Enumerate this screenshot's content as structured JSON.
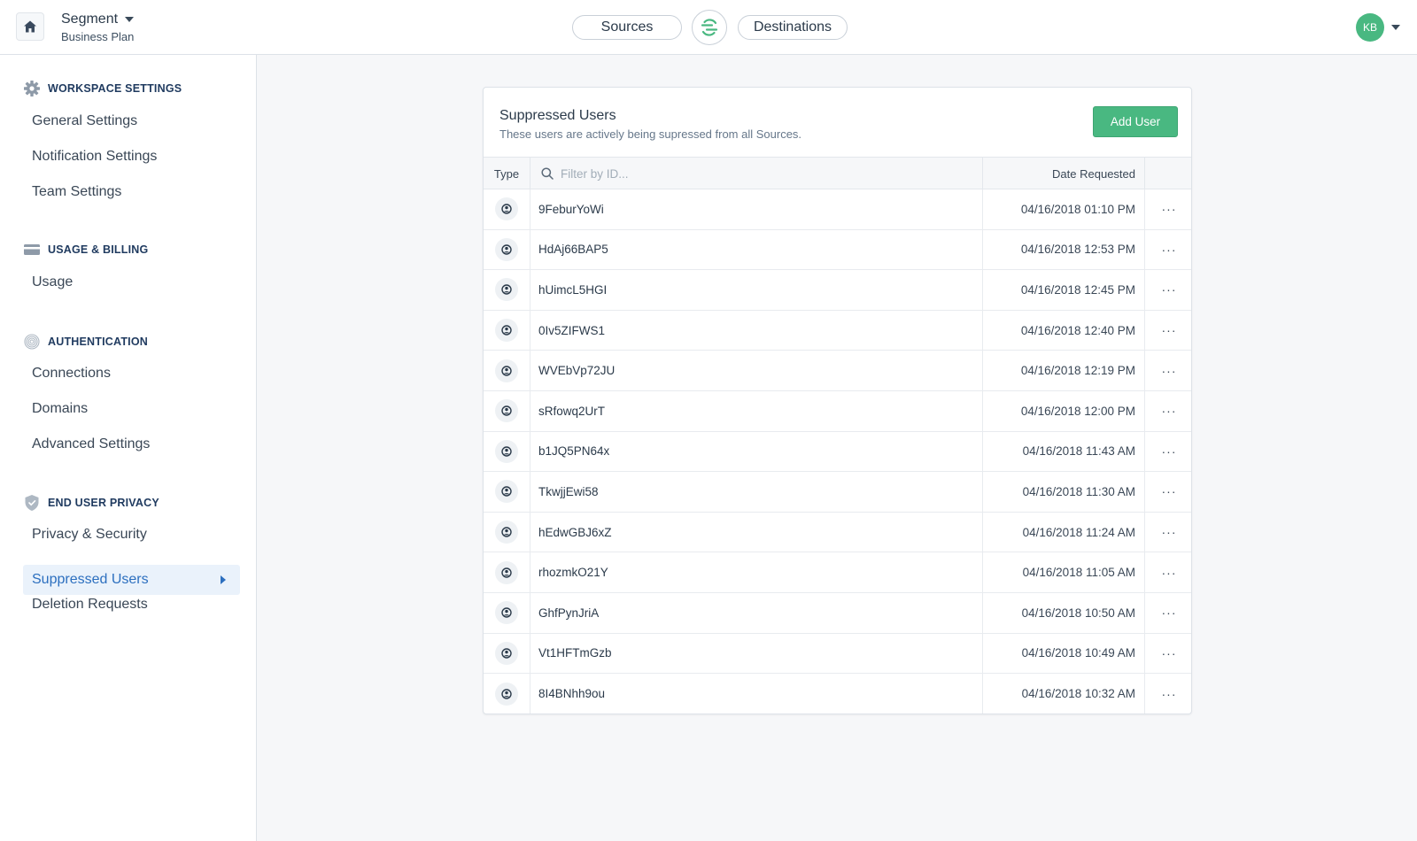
{
  "header": {
    "workspace_name": "Segment",
    "workspace_plan": "Business Plan",
    "sources_label": "Sources",
    "destinations_label": "Destinations",
    "avatar_initials": "KB"
  },
  "sidebar": {
    "sections": [
      {
        "title": "WORKSPACE SETTINGS",
        "icon": "gear-icon",
        "items": [
          "General Settings",
          "Notification Settings",
          "Team Settings"
        ]
      },
      {
        "title": "USAGE & BILLING",
        "icon": "credit-card-icon",
        "items": [
          "Usage"
        ]
      },
      {
        "title": "AUTHENTICATION",
        "icon": "fingerprint-icon",
        "items": [
          "Connections",
          "Domains",
          "Advanced Settings"
        ]
      },
      {
        "title": "END USER PRIVACY",
        "icon": "shield-icon",
        "items": [
          "Privacy & Security",
          "Suppressed Users",
          "Deletion Requests"
        ]
      }
    ],
    "active_item": "Suppressed Users"
  },
  "card": {
    "title": "Suppressed Users",
    "subtitle": "These users are actively being supressed from all Sources.",
    "add_button_label": "Add User",
    "columns": {
      "type": "Type",
      "date": "Date Requested"
    },
    "filter_placeholder": "Filter by ID...",
    "more_label": "···",
    "rows": [
      {
        "id": "9FeburYoWi",
        "date": "04/16/2018 01:10 PM"
      },
      {
        "id": "HdAj66BAP5",
        "date": "04/16/2018 12:53 PM"
      },
      {
        "id": "hUimcL5HGI",
        "date": "04/16/2018 12:45 PM"
      },
      {
        "id": "0Iv5ZIFWS1",
        "date": "04/16/2018 12:40 PM"
      },
      {
        "id": "WVEbVp72JU",
        "date": "04/16/2018 12:19 PM"
      },
      {
        "id": "sRfowq2UrT",
        "date": "04/16/2018 12:00 PM"
      },
      {
        "id": "b1JQ5PN64x",
        "date": "04/16/2018 11:43 AM"
      },
      {
        "id": "TkwjjEwi58",
        "date": "04/16/2018 11:30 AM"
      },
      {
        "id": "hEdwGBJ6xZ",
        "date": "04/16/2018 11:24 AM"
      },
      {
        "id": "rhozmkO21Y",
        "date": "04/16/2018 11:05 AM"
      },
      {
        "id": "GhfPynJriA",
        "date": "04/16/2018 10:50 AM"
      },
      {
        "id": "Vt1HFTmGzb",
        "date": "04/16/2018 10:49 AM"
      },
      {
        "id": "8I4BNhh9ou",
        "date": "04/16/2018 10:32 AM"
      }
    ]
  },
  "colors": {
    "accent_green": "#49b881",
    "active_blue": "#2c6fbf",
    "section_navy": "#1f3a5f"
  }
}
